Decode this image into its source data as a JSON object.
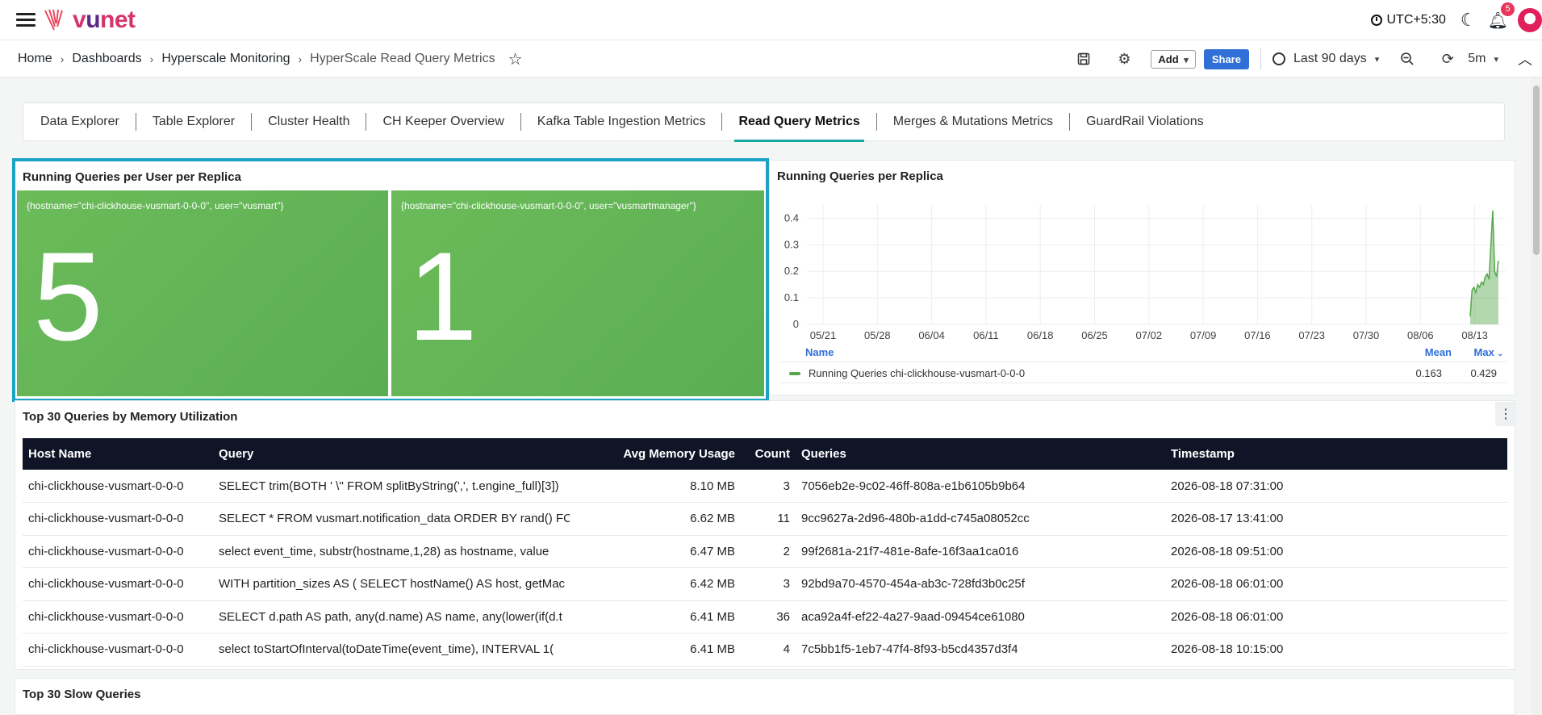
{
  "brand": {
    "name_prefix": "v",
    "name_mid": "u",
    "name_suffix": "net"
  },
  "topbar": {
    "timezone": "UTC+5:30",
    "notifications_count": "5"
  },
  "breadcrumb": {
    "items": [
      "Home",
      "Dashboards",
      "Hyperscale Monitoring"
    ],
    "current": "HyperScale Read Query Metrics"
  },
  "toolbar": {
    "add_label": "Add",
    "share_label": "Share",
    "time_range": "Last 90 days",
    "refresh_interval": "5m"
  },
  "tabs": [
    {
      "label": "Data Explorer"
    },
    {
      "label": "Table Explorer"
    },
    {
      "label": "Cluster Health"
    },
    {
      "label": "CH Keeper Overview"
    },
    {
      "label": "Kafka Table Ingestion Metrics"
    },
    {
      "label": "Read Query Metrics",
      "active": true
    },
    {
      "label": "Merges & Mutations Metrics"
    },
    {
      "label": "GuardRail Violations"
    }
  ],
  "stat_panel": {
    "title": "Running Queries per User per Replica",
    "stats": [
      {
        "label": "{hostname=\"chi-clickhouse-vusmart-0-0-0\", user=\"vusmart\"}",
        "value": "5"
      },
      {
        "label": "{hostname=\"chi-clickhouse-vusmart-0-0-0\", user=\"vusmartmanager\"}",
        "value": "1"
      }
    ],
    "color": "#62b455"
  },
  "chart_panel": {
    "title": "Running Queries per Replica",
    "legend": {
      "name_header": "Name",
      "mean_header": "Mean",
      "max_header": "Max"
    },
    "series_values": {
      "mean": "0.163",
      "max": "0.429"
    }
  },
  "chart_data": {
    "type": "area",
    "x_ticks": [
      "05/21",
      "05/28",
      "06/04",
      "06/11",
      "06/18",
      "06/25",
      "07/02",
      "07/09",
      "07/16",
      "07/23",
      "07/30",
      "08/06",
      "08/13"
    ],
    "y_ticks": [
      "0",
      "0.1",
      "0.2",
      "0.3",
      "0.4"
    ],
    "ylim": [
      0,
      0.45
    ],
    "x": [
      "08/14",
      "08/14",
      "08/15",
      "08/15",
      "08/15",
      "08/16",
      "08/16",
      "08/16",
      "08/17",
      "08/17",
      "08/17",
      "08/18",
      "08/18",
      "08/18",
      "08/19",
      "08/19"
    ],
    "series": [
      {
        "name": "Running Queries chi-clickhouse-vusmart-0-0-0",
        "color": "#56a64b",
        "values": [
          0.03,
          0.13,
          0.14,
          0.12,
          0.15,
          0.14,
          0.16,
          0.15,
          0.18,
          0.19,
          0.17,
          0.3,
          0.429,
          0.2,
          0.18,
          0.24
        ]
      }
    ],
    "grid": true,
    "legend_position": "bottom"
  },
  "table_panel": {
    "title": "Top 30 Queries by Memory Utilization",
    "columns": [
      "Host Name",
      "Query",
      "Avg Memory Usage",
      "Count",
      "Queries",
      "Timestamp"
    ],
    "rows": [
      [
        "chi-clickhouse-vusmart-0-0-0",
        "SELECT trim(BOTH ' \\'' FROM splitByString(',', t.engine_full)[3])",
        "8.10 MB",
        "3",
        "7056eb2e-9c02-46ff-808a-e1b6105b9b64",
        "2026-08-18 07:31:00"
      ],
      [
        "chi-clickhouse-vusmart-0-0-0",
        "SELECT * FROM vusmart.notification_data ORDER BY rand() FC",
        "6.62 MB",
        "11",
        "9cc9627a-2d96-480b-a1dd-c745a08052cc",
        "2026-08-17 13:41:00"
      ],
      [
        "chi-clickhouse-vusmart-0-0-0",
        "select event_time, substr(hostname,1,28) as hostname, value",
        "6.47 MB",
        "2",
        "99f2681a-21f7-481e-8afe-16f3aa1ca016",
        "2026-08-18 09:51:00"
      ],
      [
        "chi-clickhouse-vusmart-0-0-0",
        "WITH partition_sizes AS ( SELECT hostName() AS host, getMac",
        "6.42 MB",
        "3",
        "92bd9a70-4570-454a-ab3c-728fd3b0c25f",
        "2026-08-18 06:01:00"
      ],
      [
        "chi-clickhouse-vusmart-0-0-0",
        "SELECT d.path AS path, any(d.name) AS name, any(lower(if(d.t",
        "6.41 MB",
        "36",
        "aca92a4f-ef22-4a27-9aad-09454ce61080",
        "2026-08-18 06:01:00"
      ],
      [
        "chi-clickhouse-vusmart-0-0-0",
        "select toStartOfInterval(toDateTime(event_time), INTERVAL 1(",
        "6.41 MB",
        "4",
        "7c5bb1f5-1eb7-47f4-8f93-b5cd4357d3f4",
        "2026-08-18 10:15:00"
      ]
    ]
  },
  "slow_panel": {
    "title": "Top 30 Slow Queries"
  }
}
